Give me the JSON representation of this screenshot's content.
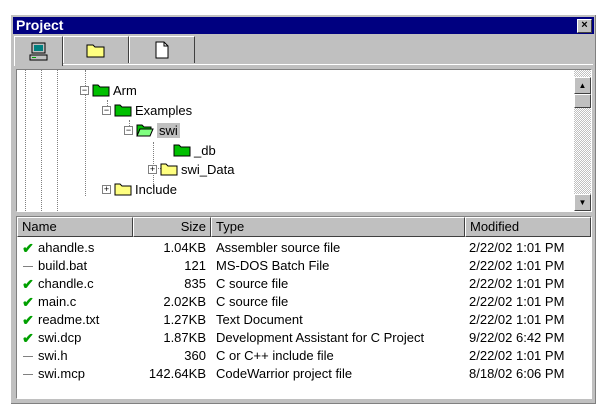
{
  "window": {
    "title": "Project",
    "close_glyph": "×"
  },
  "tabs": [
    {
      "name": "files",
      "icon": "computer-icon",
      "active": true
    },
    {
      "name": "folders",
      "icon": "folder-icon",
      "active": false
    },
    {
      "name": "documents",
      "icon": "document-icon",
      "active": false
    }
  ],
  "tree": {
    "nodes": [
      {
        "label": "Arm",
        "expander": "−",
        "icon": "folder-icon"
      },
      {
        "label": "Examples",
        "expander": "−",
        "icon": "folder-icon"
      },
      {
        "label": "swi",
        "expander": "−",
        "icon": "open-folder-icon",
        "selected": true
      },
      {
        "label": "_db",
        "expander": "",
        "icon": "folder-icon"
      },
      {
        "label": "swi_Data",
        "expander": "+",
        "icon": "folder-icon"
      },
      {
        "label": "Include",
        "expander": "+",
        "icon": "folder-icon"
      }
    ]
  },
  "file_list": {
    "columns": {
      "name": "Name",
      "size": "Size",
      "type": "Type",
      "modified": "Modified"
    },
    "rows": [
      {
        "mark": "check",
        "name": "ahandle.s",
        "size": "1.04KB",
        "type": "Assembler source file",
        "modified": "2/22/02 1:01 PM"
      },
      {
        "mark": "dash",
        "name": "build.bat",
        "size": "121",
        "type": "MS-DOS Batch File",
        "modified": "2/22/02 1:01 PM"
      },
      {
        "mark": "check",
        "name": "chandle.c",
        "size": "835",
        "type": "C source file",
        "modified": "2/22/02 1:01 PM"
      },
      {
        "mark": "check",
        "name": "main.c",
        "size": "2.02KB",
        "type": "C source file",
        "modified": "2/22/02 1:01 PM"
      },
      {
        "mark": "check",
        "name": "readme.txt",
        "size": "1.27KB",
        "type": "Text Document",
        "modified": "2/22/02 1:01 PM"
      },
      {
        "mark": "check",
        "name": "swi.dcp",
        "size": "1.87KB",
        "type": "Development Assistant for C Project",
        "modified": "9/22/02 6:42 PM"
      },
      {
        "mark": "dash",
        "name": "swi.h",
        "size": "360",
        "type": "C or C++ include file",
        "modified": "2/22/02 1:01 PM"
      },
      {
        "mark": "dash",
        "name": "swi.mcp",
        "size": "142.64KB",
        "type": "CodeWarrior project file",
        "modified": "8/18/02 6:06 PM"
      }
    ]
  },
  "colors": {
    "titlebar": "#000080",
    "folder": "#ffff80",
    "folder_green": "#00c000",
    "selection": "#c0c0c0",
    "check": "#00a000"
  }
}
